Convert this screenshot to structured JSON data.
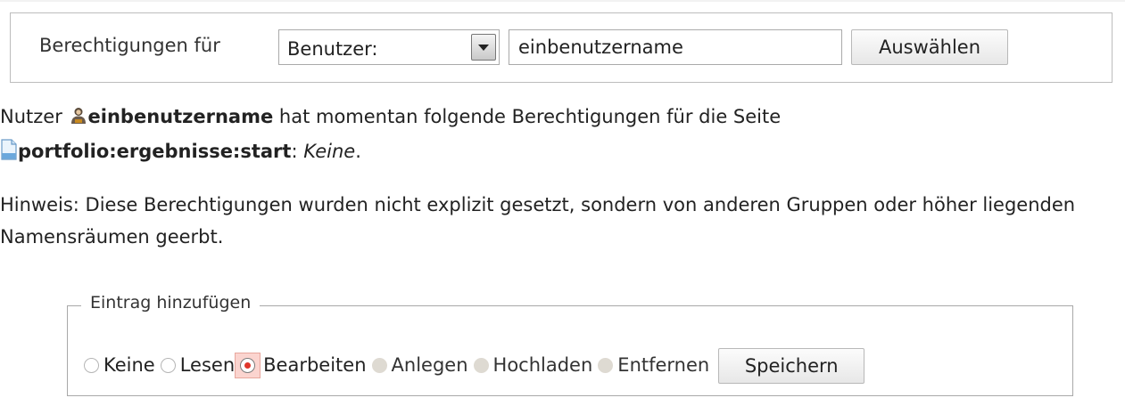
{
  "selector": {
    "label": "Berechtigungen für",
    "type_selected": "Benutzer:",
    "name_value": "einbenutzername",
    "submit_label": "Auswählen"
  },
  "info": {
    "prefix": "Nutzer",
    "user": "einbenutzername",
    "middle": "hat momentan folgende Berechtigungen für die Seite",
    "page": "portfolio:ergebnisse:start",
    "colon": ":",
    "permission": "Keine",
    "period": "."
  },
  "hint": "Hinweis: Diese Berechtigungen wurden nicht explizit gesetzt, sondern von anderen Gruppen oder höher liegenden Namensräumen geerbt.",
  "add_entry": {
    "legend": "Eintrag hinzufügen",
    "options": [
      {
        "label": "Keine",
        "state": "unchecked"
      },
      {
        "label": "Lesen",
        "state": "unchecked"
      },
      {
        "label": "Bearbeiten",
        "state": "checked"
      },
      {
        "label": "Anlegen",
        "state": "disabled"
      },
      {
        "label": "Hochladen",
        "state": "disabled"
      },
      {
        "label": "Entfernen",
        "state": "disabled"
      }
    ],
    "save_label": "Speichern"
  },
  "icons": {
    "user": "user-icon",
    "page": "page-icon"
  },
  "colors": {
    "radio_checked": "#e0362b",
    "highlight_bg": "#fbd4cf"
  }
}
